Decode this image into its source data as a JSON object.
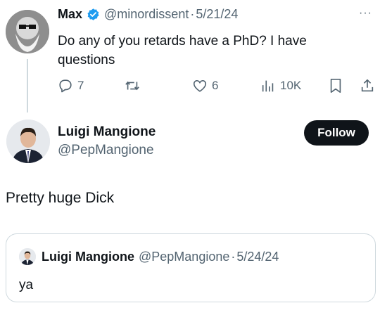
{
  "reply_tweet": {
    "author_name": "Max",
    "handle": "@minordissent",
    "dot": "·",
    "date": "5/21/24",
    "text_line1": "Do any of you retards have a PhD? I have",
    "text_line2": "questions",
    "actions": {
      "replies": "7",
      "retweets": "",
      "likes": "6",
      "views": "10K"
    },
    "more_label": "···",
    "verified_color": "#1d9bf0"
  },
  "main_tweet": {
    "author_name": "Luigi Mangione",
    "handle": "@PepMangione",
    "follow_label": "Follow",
    "text": "Pretty huge Dick"
  },
  "quoted_tweet": {
    "author_name": "Luigi Mangione",
    "handle": "@PepMangione",
    "dot": "·",
    "date": "5/24/24",
    "text": "ya"
  },
  "colors": {
    "muted": "#536471",
    "text": "#0f1419",
    "border": "#cfd9de",
    "thread_line": "#cfd9de"
  }
}
